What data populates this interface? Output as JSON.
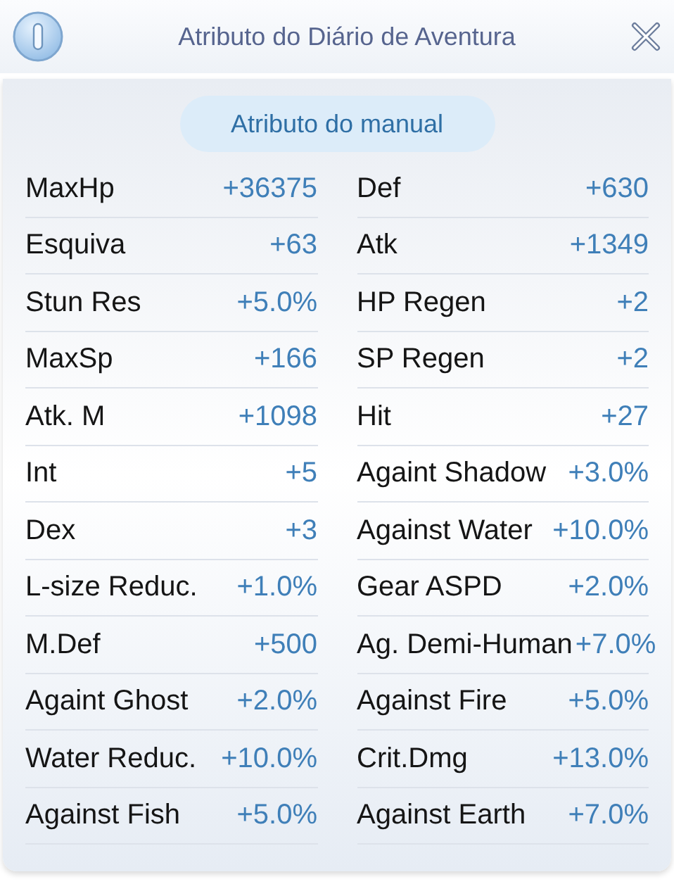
{
  "window": {
    "title": "Atributo do Diário de Aventura"
  },
  "tab": {
    "label": "Atributo do manual",
    "selected": true
  },
  "attributes": [
    {
      "label": "MaxHp",
      "value": "+36375"
    },
    {
      "label": "Def",
      "value": "+630"
    },
    {
      "label": "Esquiva",
      "value": "+63"
    },
    {
      "label": "Atk",
      "value": "+1349"
    },
    {
      "label": "Stun Res",
      "value": "+5.0%"
    },
    {
      "label": "HP Regen",
      "value": "+2"
    },
    {
      "label": "MaxSp",
      "value": "+166"
    },
    {
      "label": "SP Regen",
      "value": "+2"
    },
    {
      "label": "Atk. M",
      "value": "+1098"
    },
    {
      "label": "Hit",
      "value": "+27"
    },
    {
      "label": "Int",
      "value": "+5"
    },
    {
      "label": "Againt Shadow",
      "value": "+3.0%"
    },
    {
      "label": "Dex",
      "value": "+3"
    },
    {
      "label": "Against Water",
      "value": "+10.0%"
    },
    {
      "label": "L-size Reduc.",
      "value": "+1.0%"
    },
    {
      "label": "Gear ASPD",
      "value": "+2.0%"
    },
    {
      "label": "M.Def",
      "value": "+500"
    },
    {
      "label": "Ag. Demi-Human",
      "value": "+7.0%"
    },
    {
      "label": "Againt Ghost",
      "value": "+2.0%"
    },
    {
      "label": "Against Fire",
      "value": "+5.0%"
    },
    {
      "label": "Water Reduc.",
      "value": "+10.0%"
    },
    {
      "label": "Crit.Dmg",
      "value": "+13.0%"
    },
    {
      "label": "Against Fish",
      "value": "+5.0%"
    },
    {
      "label": "Against Earth",
      "value": "+7.0%"
    }
  ]
}
